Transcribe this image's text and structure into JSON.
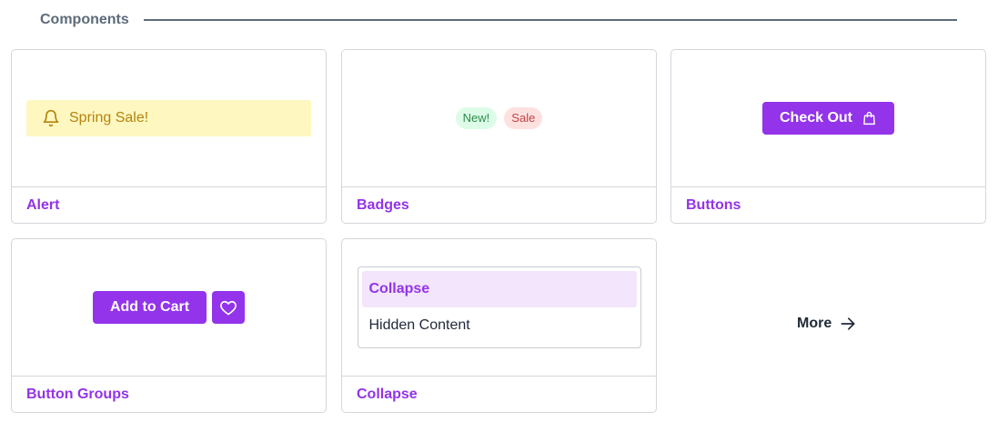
{
  "section": {
    "title": "Components"
  },
  "cards": {
    "alert": {
      "preview_text": "Spring Sale!",
      "link_label": "Alert"
    },
    "badges": {
      "badge_new": "New!",
      "badge_sale": "Sale",
      "link_label": "Badges"
    },
    "buttons": {
      "button_label": "Check Out",
      "link_label": "Buttons"
    },
    "button_groups": {
      "button_label": "Add to Cart",
      "link_label": "Button Groups"
    },
    "collapse": {
      "header_label": "Collapse",
      "content_text": "Hidden Content",
      "link_label": "Collapse"
    }
  },
  "more": {
    "label": "More"
  },
  "icons": {
    "alert": "bell-icon",
    "checkout": "shopping-bag-icon",
    "favorite": "heart-icon",
    "more": "arrow-right-icon"
  },
  "colors": {
    "accent": "#9333ea",
    "alert_bg": "#fef7c0",
    "alert_text": "#b4840d",
    "badge_new_bg": "#dcfce7",
    "badge_sale_bg": "#fde0e0",
    "collapse_header_bg": "#f3e5fc"
  }
}
